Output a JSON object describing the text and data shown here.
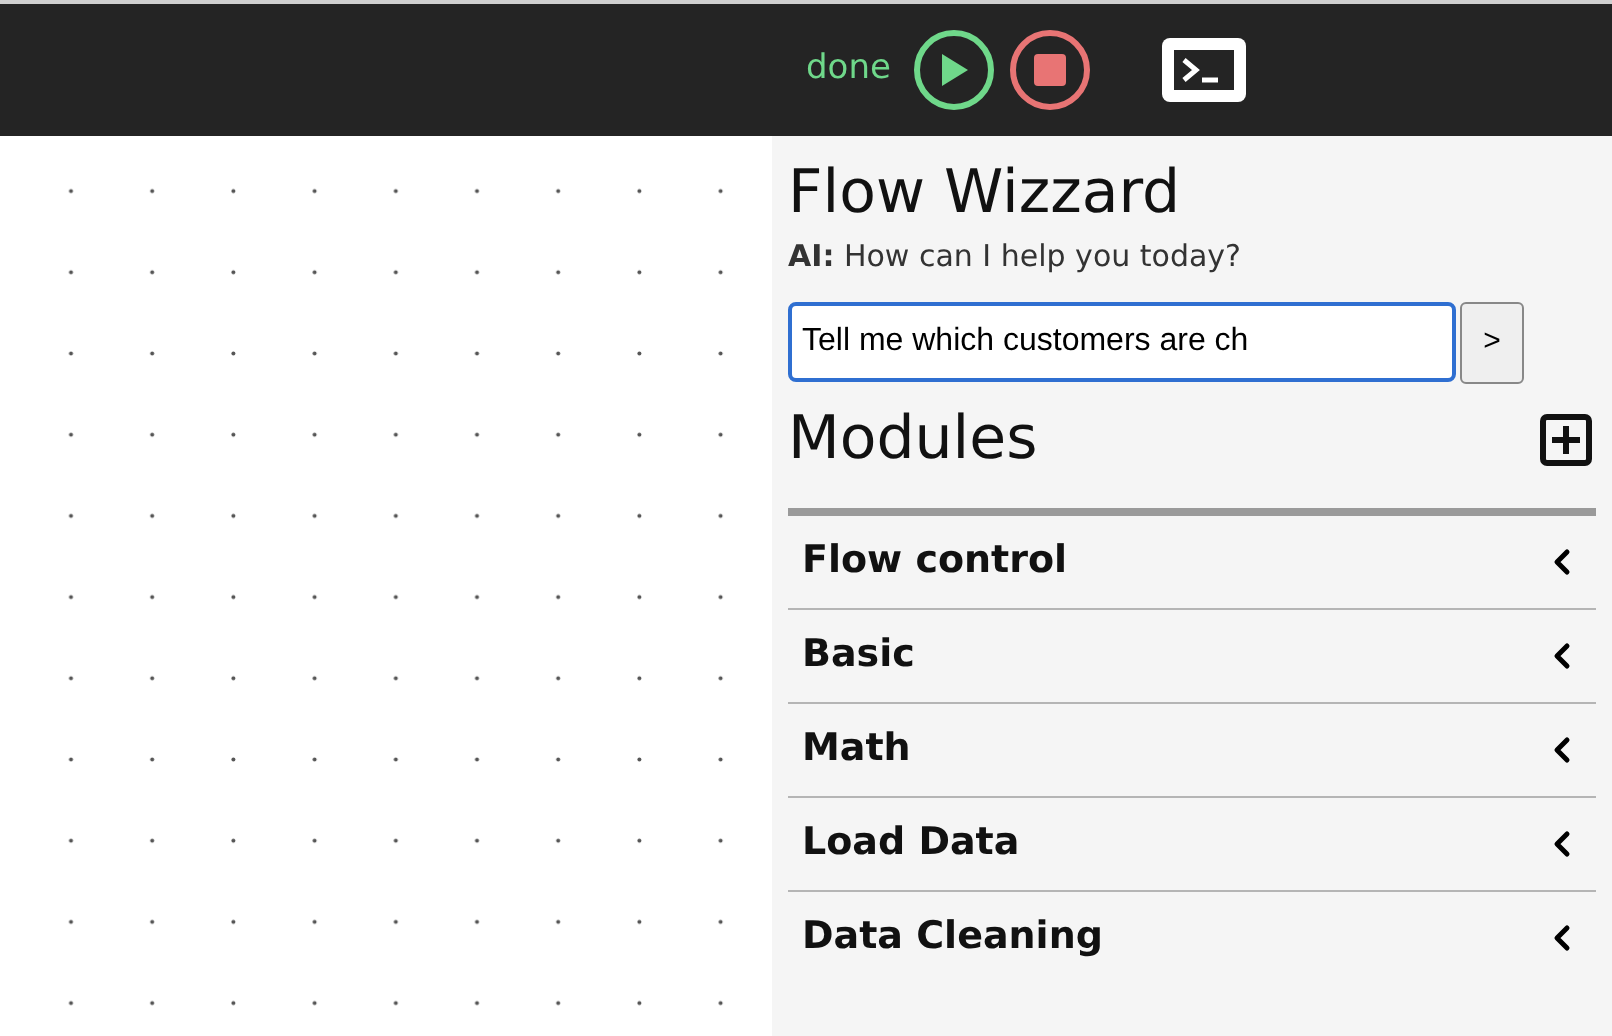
{
  "toolbar": {
    "status": "done"
  },
  "wizard": {
    "title": "Flow Wizzard",
    "prompt": "**AI:** How can I help you today?",
    "input_value": "Tell me which customers are ch",
    "send_label": ">"
  },
  "modules": {
    "title": "Modules",
    "items": [
      {
        "label": "Flow control",
        "expanded": false
      },
      {
        "label": "Basic",
        "expanded": false
      },
      {
        "label": "Math",
        "expanded": false
      },
      {
        "label": "Load Data",
        "expanded": false
      },
      {
        "label": "Data Cleaning",
        "expanded": false
      }
    ]
  }
}
